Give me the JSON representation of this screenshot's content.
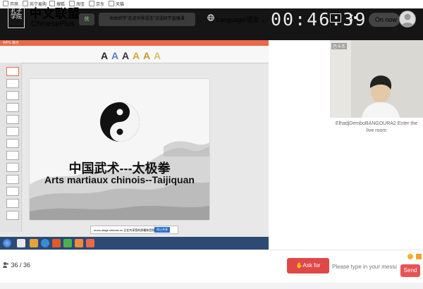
{
  "bookmarks": [
    "百度",
    "苏宁易购",
    "搜狐",
    "淘宝",
    "京东",
    "天猫"
  ],
  "header": {
    "logo_mark": "孔子学院",
    "logo_cn": "中文联盟",
    "logo_en": "ChinesePlus",
    "vip_label": "优",
    "notice": "佑佑研学\"走进世界语言\"汉语研学直播课",
    "language_label": "Language/语言",
    "timer": "00:46:39",
    "status_label": "On now"
  },
  "presentation": {
    "app_title": "WPS 演示",
    "title_cn": "中国武术---太极拳",
    "title_fr": "Arts martiaux chinois--Taijiquan",
    "share_notice": "mooc-stage.chinese.cn 正在共享您的屏幕和音频",
    "share_button": "停止共享"
  },
  "video": {
    "participant_name": "巴卡杰"
  },
  "chat": {
    "system_message": "ElhadjDemboBANGOURA2 Enter the live room",
    "input_placeholder": "Please type in your message",
    "send_label": "Send"
  },
  "footer": {
    "people_count": "36 / 36",
    "ask_label": "Ask for speaking"
  },
  "colors": {
    "header_bg": "#151515",
    "ask_button": "#e04848",
    "send_button": "#e85454",
    "wps_accent": "#e9694a"
  }
}
